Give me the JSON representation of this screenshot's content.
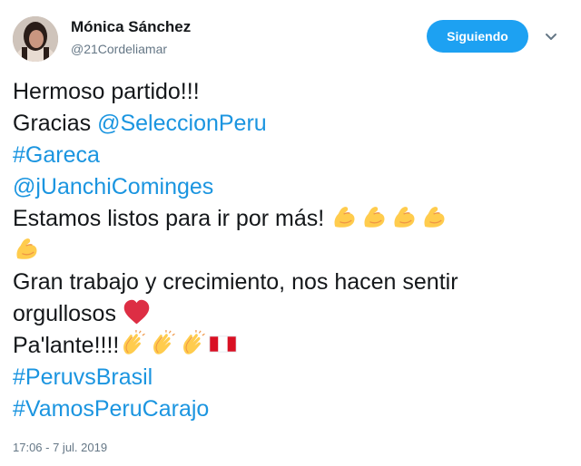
{
  "user": {
    "name": "Mónica Sánchez",
    "handle": "@21Cordeliamar"
  },
  "follow_button": {
    "label": "Siguiendo",
    "color": "#1da1f2"
  },
  "tweet": {
    "line1": "Hermoso partido!!!",
    "line2_text": "Gracias ",
    "line2_mention": "@SeleccionPeru",
    "hashtag_gareca": "#Gareca",
    "mention_juanchi": "@jUanchiCominges",
    "line5_text": "Estamos listos para ir por más! ",
    "line6_text": "Gran trabajo y crecimiento, nos hacen sentir",
    "line7_text": "orgullosos ",
    "line8_text": "Pa'lante!!!!",
    "hashtag_peruvsbrasil": "#PeruvsBrasil",
    "hashtag_vamos": "#VamosPeruCarajo",
    "link_color": "#1b95e0"
  },
  "icons": {
    "strong_arm": "flexed-biceps-emoji",
    "heart": "red-heart-emoji",
    "clap": "clapping-hands-emoji",
    "flag": "peru-flag-emoji",
    "caret": "chevron-down-icon"
  },
  "timestamp": "17:06 - 7 jul. 2019"
}
